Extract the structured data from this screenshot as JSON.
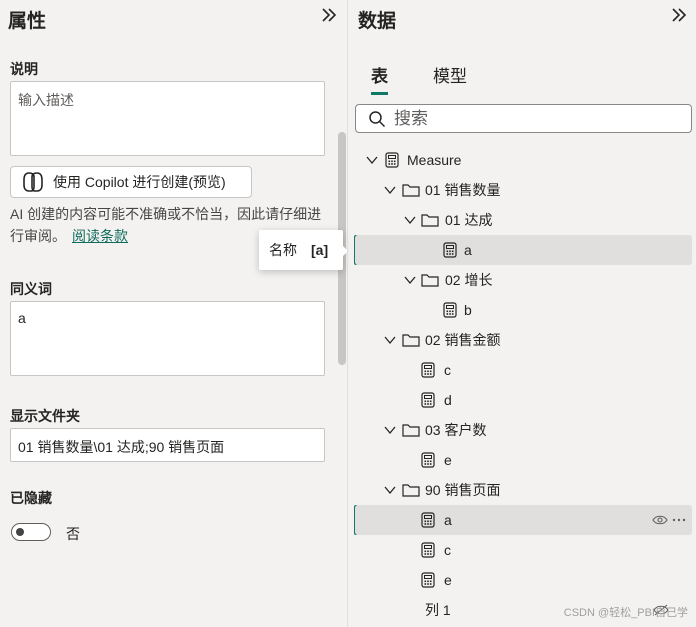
{
  "properties": {
    "title": "属性",
    "description_label": "说明",
    "description_placeholder": "输入描述",
    "copilot_button": "使用 Copilot 进行创建(预览)",
    "ai_note": "AI 创建的内容可能不准确或不恰当，因此请仔细进行审阅。",
    "ai_note_link": "阅读条款",
    "synonyms_label": "同义词",
    "synonyms_value": "a",
    "display_folder_label": "显示文件夹",
    "display_folder_value": "01 销售数量\\01 达成;90 销售页面",
    "hidden_label": "已隐藏",
    "hidden_value": "否"
  },
  "tooltip": {
    "key": "名称",
    "value": "[a]"
  },
  "data_pane": {
    "title": "数据",
    "tabs": [
      {
        "label": "表",
        "active": true
      },
      {
        "label": "模型",
        "active": false
      }
    ],
    "search_placeholder": "搜索",
    "tree": [
      {
        "label": "Measure",
        "kind": "table",
        "expanded": true
      },
      {
        "label": "01 销售数量",
        "kind": "folder",
        "expanded": true
      },
      {
        "label": "01 达成",
        "kind": "folder",
        "expanded": true
      },
      {
        "label": "a",
        "kind": "measure",
        "selected": true
      },
      {
        "label": "02 增长",
        "kind": "folder",
        "expanded": true
      },
      {
        "label": "b",
        "kind": "measure"
      },
      {
        "label": "02 销售金额",
        "kind": "folder",
        "expanded": true
      },
      {
        "label": "c",
        "kind": "measure"
      },
      {
        "label": "d",
        "kind": "measure"
      },
      {
        "label": "03 客户数",
        "kind": "folder",
        "expanded": true
      },
      {
        "label": "e",
        "kind": "measure"
      },
      {
        "label": "90 销售页面",
        "kind": "folder",
        "expanded": true
      },
      {
        "label": "a",
        "kind": "measure",
        "selected": true,
        "actions": [
          "eye-icon",
          "more-icon"
        ]
      },
      {
        "label": "c",
        "kind": "measure"
      },
      {
        "label": "e",
        "kind": "measure"
      },
      {
        "label": "列 1",
        "kind": "column",
        "hidden": true
      }
    ]
  },
  "watermark": "CSDN @轻松_PBI自己学",
  "colors": {
    "accent": "#117865",
    "selected_row": "#e1dfdd",
    "background": "#f3f2f1"
  }
}
